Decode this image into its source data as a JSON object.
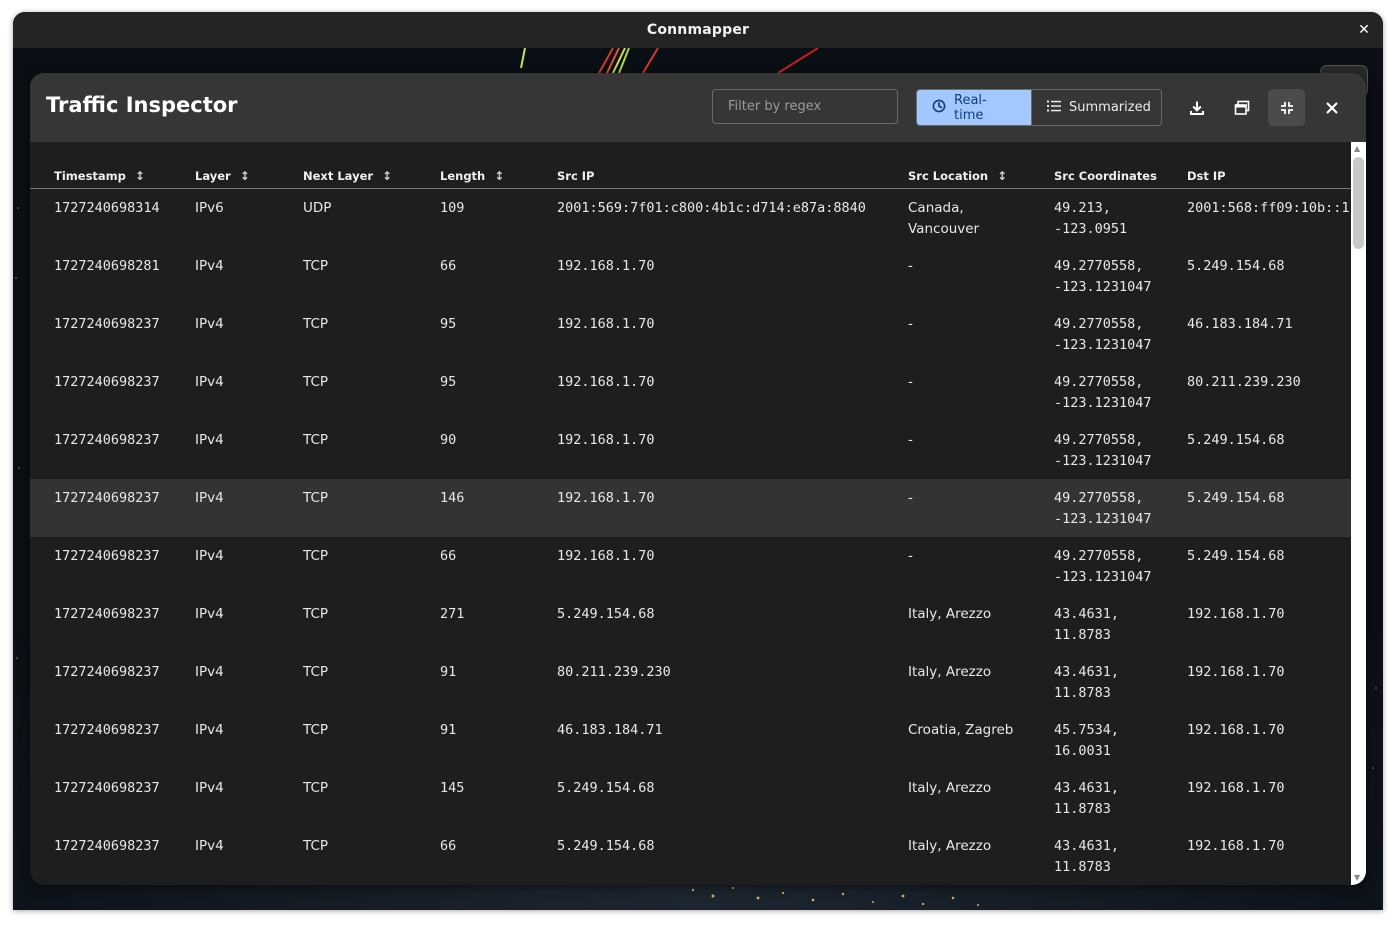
{
  "window": {
    "title": "Connmapper"
  },
  "panel": {
    "title": "Traffic Inspector",
    "filter_placeholder": "Filter by regex",
    "modes": {
      "realtime_label": "Real-time",
      "summarized_label": "Summarized",
      "active": "Real-time"
    }
  },
  "icons": {
    "close": "close-icon",
    "download": "download-icon",
    "popout": "window-popout-icon",
    "collapse": "collapse-icon",
    "clock": "clock-icon",
    "list": "list-icon",
    "sort": "sort-arrows-icon"
  },
  "colors": {
    "accent": "#a3c8ff",
    "accent_text": "#0e3f7a",
    "header_bg": "#363636",
    "body_bg": "#1e1e1e",
    "highlight_row": "#333333"
  },
  "table": {
    "columns": [
      "Timestamp",
      "Layer",
      "Next Layer",
      "Length",
      "Src IP",
      "Src Location",
      "Src Coordinates",
      "Dst IP"
    ],
    "sortable": [
      true,
      true,
      true,
      true,
      false,
      true,
      false,
      false
    ],
    "highlighted_row": 5,
    "rows": [
      {
        "timestamp": "1727240698314",
        "layer": "IPv6",
        "next_layer": "UDP",
        "length": "109",
        "src_ip": "2001:569:7f01:c800:4b1c:d714:e87a:8840",
        "src_location": "Canada, Vancouver",
        "src_coords_1": "49.213,",
        "src_coords_2": "-123.0951",
        "dst_ip": "2001:568:ff09:10b::1"
      },
      {
        "timestamp": "1727240698281",
        "layer": "IPv4",
        "next_layer": "TCP",
        "length": "66",
        "src_ip": "192.168.1.70",
        "src_location": "-",
        "src_coords_1": "49.2770558,",
        "src_coords_2": "-123.1231047",
        "dst_ip": "5.249.154.68"
      },
      {
        "timestamp": "1727240698237",
        "layer": "IPv4",
        "next_layer": "TCP",
        "length": "95",
        "src_ip": "192.168.1.70",
        "src_location": "-",
        "src_coords_1": "49.2770558,",
        "src_coords_2": "-123.1231047",
        "dst_ip": "46.183.184.71"
      },
      {
        "timestamp": "1727240698237",
        "layer": "IPv4",
        "next_layer": "TCP",
        "length": "95",
        "src_ip": "192.168.1.70",
        "src_location": "-",
        "src_coords_1": "49.2770558,",
        "src_coords_2": "-123.1231047",
        "dst_ip": "80.211.239.230"
      },
      {
        "timestamp": "1727240698237",
        "layer": "IPv4",
        "next_layer": "TCP",
        "length": "90",
        "src_ip": "192.168.1.70",
        "src_location": "-",
        "src_coords_1": "49.2770558,",
        "src_coords_2": "-123.1231047",
        "dst_ip": "5.249.154.68"
      },
      {
        "timestamp": "1727240698237",
        "layer": "IPv4",
        "next_layer": "TCP",
        "length": "146",
        "src_ip": "192.168.1.70",
        "src_location": "-",
        "src_coords_1": "49.2770558,",
        "src_coords_2": "-123.1231047",
        "dst_ip": "5.249.154.68"
      },
      {
        "timestamp": "1727240698237",
        "layer": "IPv4",
        "next_layer": "TCP",
        "length": "66",
        "src_ip": "192.168.1.70",
        "src_location": "-",
        "src_coords_1": "49.2770558,",
        "src_coords_2": "-123.1231047",
        "dst_ip": "5.249.154.68"
      },
      {
        "timestamp": "1727240698237",
        "layer": "IPv4",
        "next_layer": "TCP",
        "length": "271",
        "src_ip": "5.249.154.68",
        "src_location": "Italy, Arezzo",
        "src_coords_1": "43.4631,",
        "src_coords_2": "11.8783",
        "dst_ip": "192.168.1.70"
      },
      {
        "timestamp": "1727240698237",
        "layer": "IPv4",
        "next_layer": "TCP",
        "length": "91",
        "src_ip": "80.211.239.230",
        "src_location": "Italy, Arezzo",
        "src_coords_1": "43.4631,",
        "src_coords_2": "11.8783",
        "dst_ip": "192.168.1.70"
      },
      {
        "timestamp": "1727240698237",
        "layer": "IPv4",
        "next_layer": "TCP",
        "length": "91",
        "src_ip": "46.183.184.71",
        "src_location": "Croatia, Zagreb",
        "src_coords_1": "45.7534,",
        "src_coords_2": "16.0031",
        "dst_ip": "192.168.1.70"
      },
      {
        "timestamp": "1727240698237",
        "layer": "IPv4",
        "next_layer": "TCP",
        "length": "145",
        "src_ip": "5.249.154.68",
        "src_location": "Italy, Arezzo",
        "src_coords_1": "43.4631,",
        "src_coords_2": "11.8783",
        "dst_ip": "192.168.1.70"
      },
      {
        "timestamp": "1727240698237",
        "layer": "IPv4",
        "next_layer": "TCP",
        "length": "66",
        "src_ip": "5.249.154.68",
        "src_location": "Italy, Arezzo",
        "src_coords_1": "43.4631,",
        "src_coords_2": "11.8783",
        "dst_ip": "192.168.1.70"
      }
    ]
  }
}
